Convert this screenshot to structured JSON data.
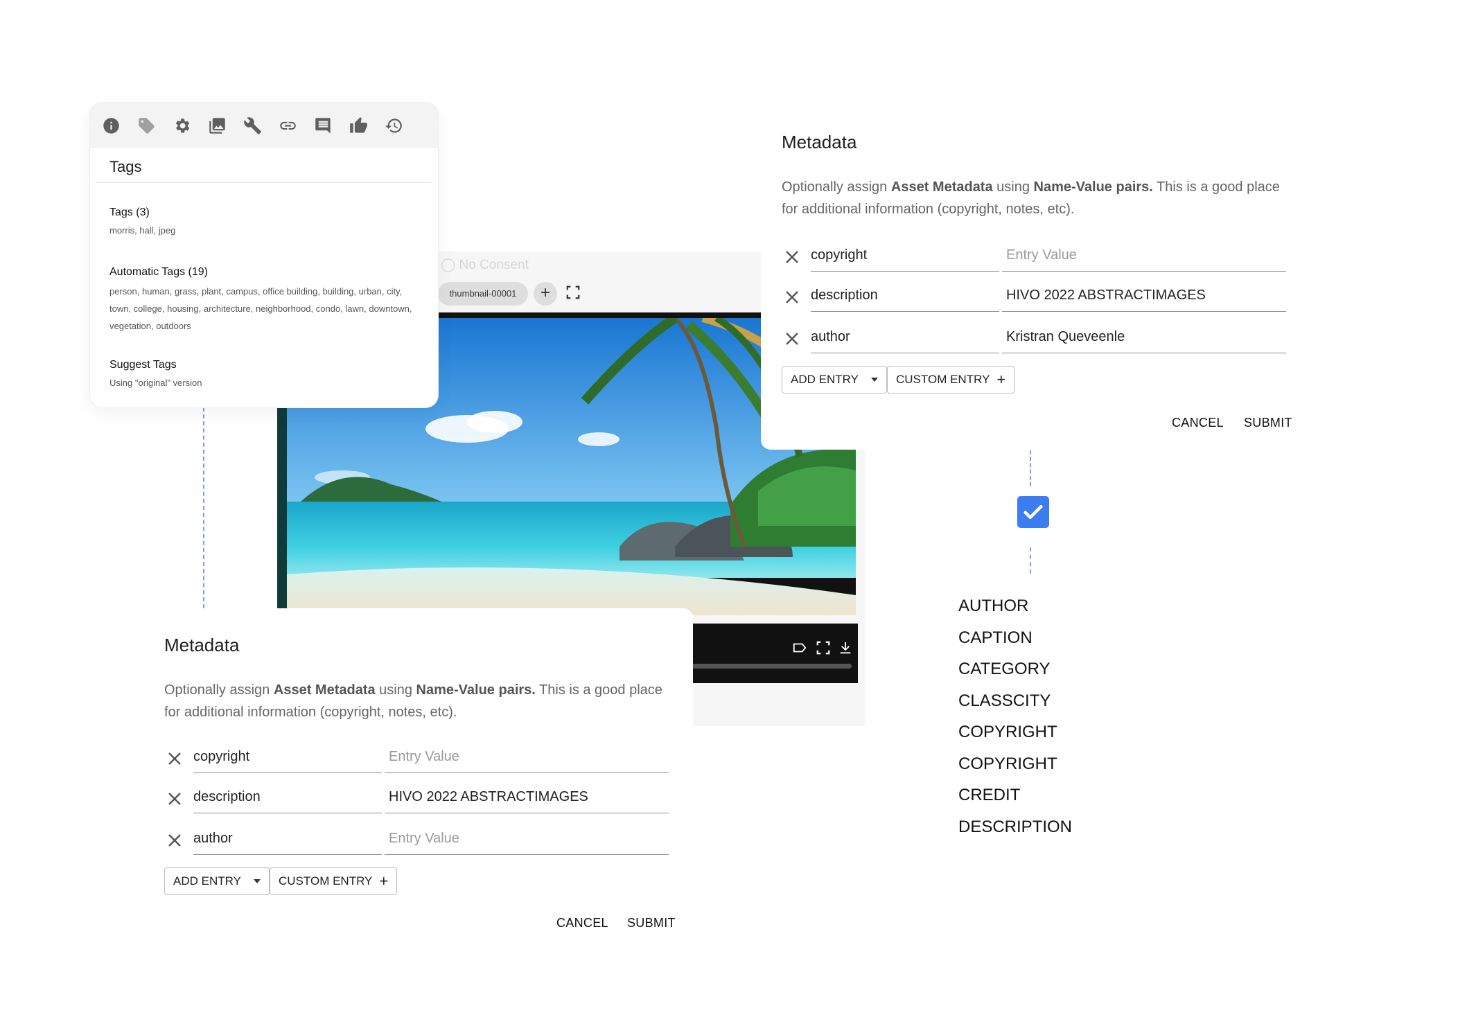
{
  "tags_panel": {
    "toolbar_icons": [
      "info-icon",
      "tag-icon",
      "gear-icon",
      "gallery-icon",
      "wrench-icon",
      "link-icon",
      "comment-icon",
      "thumbs-up-icon",
      "history-icon"
    ],
    "heading": "Tags",
    "tags_title": "Tags (3)",
    "tags_values": "morris, hall, jpeg",
    "auto_title": "Automatic Tags (19)",
    "auto_values": "person, human, grass, plant, campus, office building, building, urban, city, town, college, housing, architecture, neighborhood, condo, lawn, downtown, vegetation, outdoors",
    "suggest_title": "Suggest Tags",
    "suggest_note": "Using \"original\" version"
  },
  "viewer": {
    "consent_label": "No Consent",
    "thumbnail_label": "thumbnail-00001",
    "add_symbol": "+"
  },
  "metadata_top": {
    "title": "Metadata",
    "desc_prefix": "Optionally assign ",
    "desc_bold1": "Asset Metadata",
    "desc_mid": " using ",
    "desc_bold2": "Name-Value pairs.",
    "desc_suffix": " This is a good place for additional information (copyright, notes, etc).",
    "rows": [
      {
        "name": "copyright",
        "value": "",
        "placeholder": "Entry Value"
      },
      {
        "name": "description",
        "value": "HIVO 2022 ABSTRACTIMAGES",
        "placeholder": "Entry Value"
      },
      {
        "name": "author",
        "value": "Kristran Queveenle",
        "placeholder": "Entry Value"
      }
    ],
    "add_entry": "ADD ENTRY",
    "custom_entry": "CUSTOM ENTRY",
    "cancel": "CANCEL",
    "submit": "SUBMIT"
  },
  "metadata_bottom": {
    "title": "Metadata",
    "desc_prefix": "Optionally assign ",
    "desc_bold1": "Asset Metadata",
    "desc_mid": " using ",
    "desc_bold2": "Name-Value pairs.",
    "desc_suffix": " This is a good place for additional information (copyright, notes, etc).",
    "rows": [
      {
        "name": "copyright",
        "value": "",
        "placeholder": "Entry Value"
      },
      {
        "name": "description",
        "value": "HIVO 2022 ABSTRACTIMAGES",
        "placeholder": "Entry Value"
      },
      {
        "name": "author",
        "value": "",
        "placeholder": "Entry Value"
      }
    ],
    "add_entry": "ADD ENTRY",
    "custom_entry": "CUSTOM ENTRY",
    "cancel": "CANCEL",
    "submit": "SUBMIT"
  },
  "field_list": [
    "AUTHOR",
    "CAPTION",
    "CATEGORY",
    "CLASSCITY",
    "COPYRIGHT",
    "COPYRIGHT",
    "CREDIT",
    "DESCRIPTION"
  ],
  "colors": {
    "checkbox_accent": "#3d7df2",
    "connector_dash": "#7c9cf0"
  }
}
